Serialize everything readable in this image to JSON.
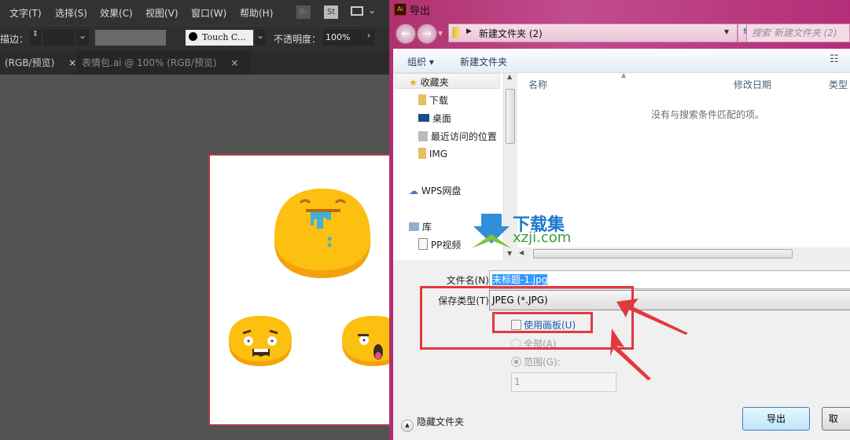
{
  "illustrator": {
    "menu": [
      "文字(T)",
      "选择(S)",
      "效果(C)",
      "视图(V)",
      "窗口(W)",
      "帮助(H)"
    ],
    "menu_right_icons": [
      "Br",
      "St",
      "workspace-switcher-icon"
    ],
    "control_bar": {
      "stroke_label": "描边：",
      "brush_label": "Touch C...",
      "opacity_label": "不透明度：",
      "opacity_value": "100%"
    },
    "tabs": [
      {
        "label": "(RGB/预览)",
        "active": true
      },
      {
        "label": "表情包.ai @ 100% (RGB/预览)",
        "active": false
      }
    ],
    "tab_close_glyph": "×"
  },
  "dialog": {
    "title": "导出",
    "app_icon_label": "Ai",
    "address_path": "新建文件夹 (2)",
    "search_placeholder": "搜索 新建文件夹 (2)",
    "toolbar": {
      "organize": "组织 ▾",
      "new_folder": "新建文件夹"
    },
    "nav_items": [
      {
        "label": "收藏夹",
        "icon": "star-icon"
      },
      {
        "label": "下载",
        "icon": "download-folder-icon"
      },
      {
        "label": "桌面",
        "icon": "desktop-icon"
      },
      {
        "label": "最近访问的位置",
        "icon": "recent-places-icon"
      },
      {
        "label": "IMG",
        "icon": "folder-icon"
      },
      {
        "label": "WPS网盘",
        "icon": "cloud-icon"
      },
      {
        "label": "库",
        "icon": "library-icon"
      },
      {
        "label": "PP视频",
        "icon": "file-icon"
      }
    ],
    "columns": [
      "名称",
      "修改日期",
      "类型"
    ],
    "empty_message": "没有与搜索条件匹配的项。",
    "filename_label": "文件名(N):",
    "filename_value": "未标题-1.jpg",
    "filetype_label": "保存类型(T):",
    "filetype_value": "JPEG (*.JPG)",
    "use_artboard_label": "使用画板(U)",
    "use_artboard_checked": false,
    "all_label": "全部(A)",
    "range_label": "范围(G):",
    "range_value": "1",
    "hide_folders_label": "隐藏文件夹",
    "export_button": "导出",
    "cancel_button": "取"
  },
  "watermark": {
    "brand": "下载集",
    "domain": "xzji.com"
  },
  "colors": {
    "annotation_red": "#e0393e",
    "emoji_yellow": "#fcc010",
    "selection_blue": "#3399ff"
  }
}
